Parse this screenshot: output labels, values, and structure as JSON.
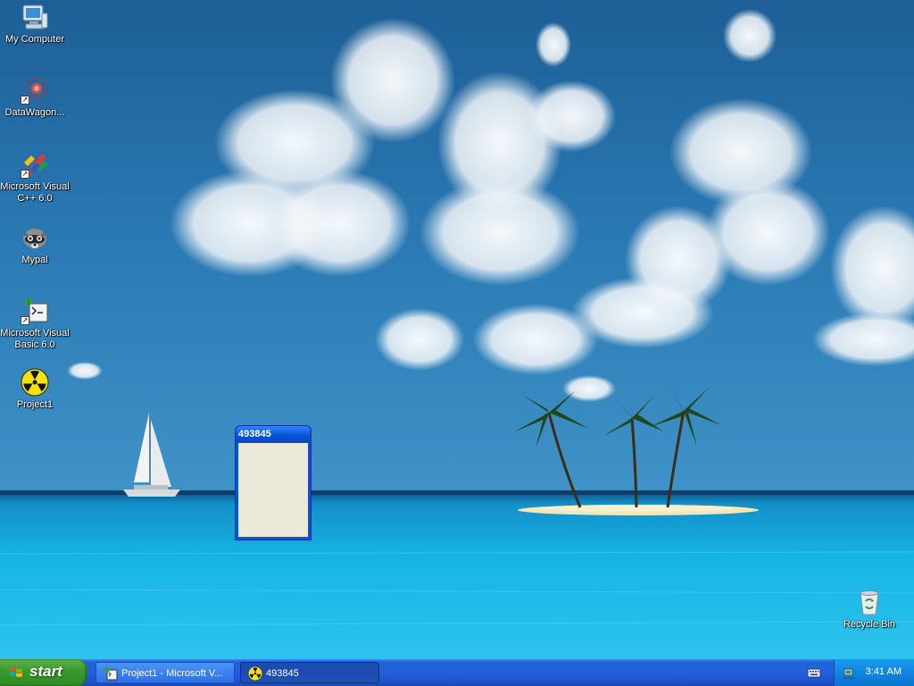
{
  "desktop": {
    "icons": [
      {
        "label": "My Computer"
      },
      {
        "label": "DataWagon..."
      },
      {
        "label": "Microsoft Visual C++ 6.0"
      },
      {
        "label": "Mypal"
      },
      {
        "label": "Microsoft Visual Basic 6.0"
      },
      {
        "label": "Project1"
      },
      {
        "label": "Recycle Bin"
      }
    ]
  },
  "window": {
    "title": "493845"
  },
  "taskbar": {
    "start_label": "start",
    "buttons": [
      {
        "label": "Project1 - Microsoft V..."
      },
      {
        "label": "493845"
      }
    ],
    "clock": "3:41 AM"
  },
  "colors": {
    "taskbar_blue": "#245edb",
    "start_green": "#3c9a2e",
    "window_title_blue": "#0a52d6",
    "window_client": "#ece9d8"
  }
}
